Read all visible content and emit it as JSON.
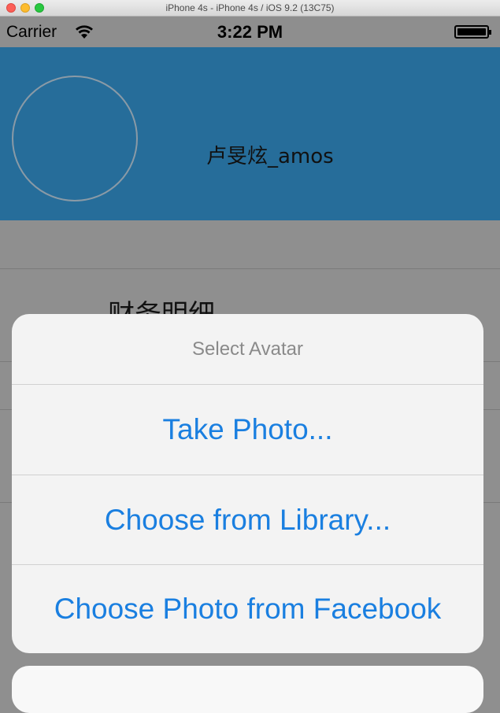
{
  "window": {
    "title": "iPhone 4s - iPhone 4s / iOS 9.2 (13C75)"
  },
  "status_bar": {
    "carrier": "Carrier",
    "time": "3:22 PM",
    "battery_level": 1.0
  },
  "profile": {
    "username": "卢旻炫_amos"
  },
  "table": {
    "visible_row_label": "财务明细"
  },
  "action_sheet": {
    "title": "Select Avatar",
    "actions": [
      "Take Photo...",
      "Choose from Library...",
      "Choose Photo from Facebook"
    ]
  },
  "colors": {
    "header": "#266d9a",
    "action_text": "#1a7fe0",
    "sheet_bg": "#f3f3f3"
  }
}
